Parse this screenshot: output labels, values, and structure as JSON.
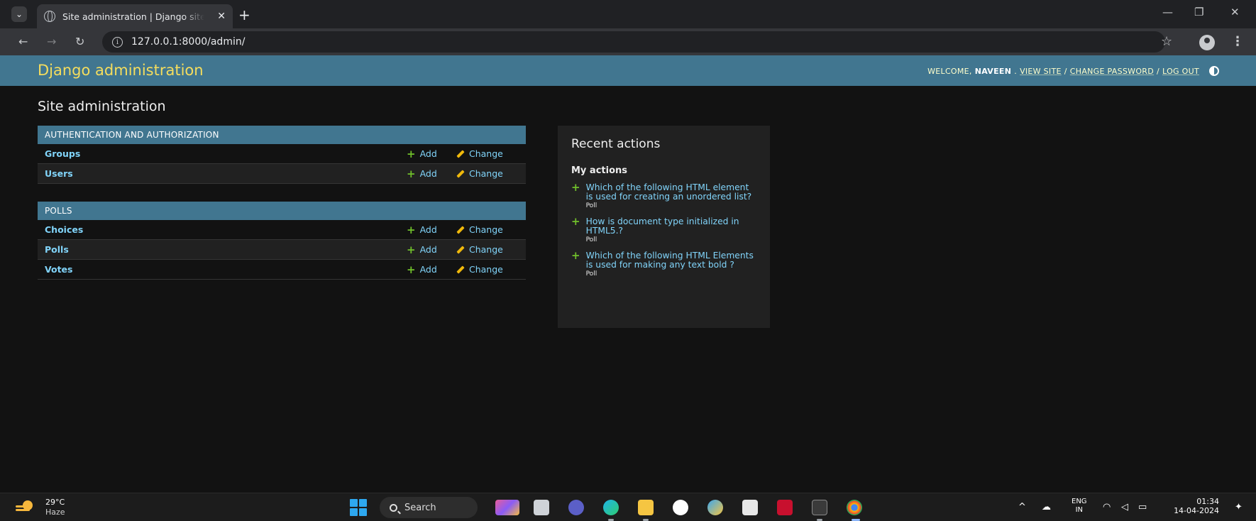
{
  "browser": {
    "tab_title": "Site administration | Django site admin",
    "url": "127.0.0.1:8000/admin/",
    "new_tab": "+",
    "tab_close": "✕"
  },
  "header": {
    "brand": "Django administration",
    "welcome": "WELCOME,",
    "username": "NAVEEN",
    "view_site": "VIEW SITE",
    "change_password": "CHANGE PASSWORD",
    "log_out": "LOG OUT",
    "separator": "/"
  },
  "page": {
    "title": "Site administration"
  },
  "modules": [
    {
      "caption": "AUTHENTICATION AND AUTHORIZATION",
      "rows": [
        {
          "name": "Groups",
          "add": "Add",
          "change": "Change"
        },
        {
          "name": "Users",
          "add": "Add",
          "change": "Change"
        }
      ]
    },
    {
      "caption": "POLLS",
      "rows": [
        {
          "name": "Choices",
          "add": "Add",
          "change": "Change"
        },
        {
          "name": "Polls",
          "add": "Add",
          "change": "Change"
        },
        {
          "name": "Votes",
          "add": "Add",
          "change": "Change"
        }
      ]
    }
  ],
  "recent_actions": {
    "title": "Recent actions",
    "subtitle": "My actions",
    "items": [
      {
        "text": "Which of the following HTML element is used for creating an unordered list?",
        "type": "Poll"
      },
      {
        "text": "How is document type initialized in HTML5.?",
        "type": "Poll"
      },
      {
        "text": "Which of the following HTML Elements is used for making any text bold ?",
        "type": "Poll"
      }
    ]
  },
  "taskbar": {
    "temperature": "29°C",
    "weather": "Haze",
    "search_label": "Search",
    "lang_top": "ENG",
    "lang_bottom": "IN",
    "time": "01:34",
    "date": "14-04-2024"
  },
  "colors": {
    "header_bg": "#417690",
    "brand": "#f5dd5d",
    "link": "#81d4fa",
    "add_icon": "#70bf2b",
    "change_icon": "#efb80b",
    "page_bg": "#121212"
  }
}
